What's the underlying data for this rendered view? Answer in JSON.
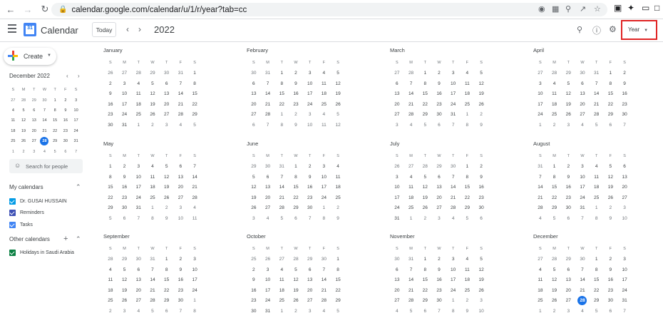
{
  "browser": {
    "url": "calendar.google.com/calendar/u/1/r/year?tab=cc"
  },
  "header": {
    "app_name": "Calendar",
    "logo_text": "31",
    "today_label": "Today",
    "year": "2022",
    "view": "Year"
  },
  "sidebar": {
    "create_label": "Create",
    "mini_title": "December 2022",
    "mini_heads": [
      "S",
      "M",
      "T",
      "W",
      "T",
      "F",
      "S"
    ],
    "mini_weeks": [
      [
        27,
        28,
        29,
        30,
        1,
        2,
        3
      ],
      [
        4,
        5,
        6,
        7,
        8,
        9,
        10
      ],
      [
        11,
        12,
        13,
        14,
        15,
        16,
        17
      ],
      [
        18,
        19,
        20,
        21,
        22,
        23,
        24
      ],
      [
        25,
        26,
        27,
        28,
        29,
        30,
        31
      ],
      [
        1,
        2,
        3,
        4,
        5,
        6,
        7
      ]
    ],
    "mini_outside": [
      [
        1,
        1,
        1,
        1,
        0,
        0,
        0
      ],
      [
        0,
        0,
        0,
        0,
        0,
        0,
        0
      ],
      [
        0,
        0,
        0,
        0,
        0,
        0,
        0
      ],
      [
        0,
        0,
        0,
        0,
        0,
        0,
        0
      ],
      [
        0,
        0,
        0,
        0,
        0,
        0,
        0
      ],
      [
        1,
        1,
        1,
        1,
        1,
        1,
        1
      ]
    ],
    "today_day": 28,
    "search_people": "Search for people",
    "my_calendars_title": "My calendars",
    "my_calendars": [
      {
        "label": "Dr. GUSAI HUSSAIN",
        "color": "#039be5"
      },
      {
        "label": "Reminders",
        "color": "#3f51b5"
      },
      {
        "label": "Tasks",
        "color": "#4285f4"
      }
    ],
    "other_calendars_title": "Other calendars",
    "other_calendars": [
      {
        "label": "Holidays in Saudi Arabia",
        "color": "#0b8043"
      }
    ]
  },
  "weekday_heads": [
    "S",
    "M",
    "T",
    "W",
    "T",
    "F",
    "S"
  ],
  "months": [
    {
      "name": "January",
      "weeks": [
        [
          26,
          27,
          28,
          29,
          30,
          31,
          1
        ],
        [
          2,
          3,
          4,
          5,
          6,
          7,
          8
        ],
        [
          9,
          10,
          11,
          12,
          13,
          14,
          15
        ],
        [
          16,
          17,
          18,
          19,
          20,
          21,
          22
        ],
        [
          23,
          24,
          25,
          26,
          27,
          28,
          29
        ],
        [
          30,
          31,
          1,
          2,
          3,
          4,
          5
        ]
      ]
    },
    {
      "name": "February",
      "weeks": [
        [
          30,
          31,
          1,
          2,
          3,
          4,
          5
        ],
        [
          6,
          7,
          8,
          9,
          10,
          11,
          12
        ],
        [
          13,
          14,
          15,
          16,
          17,
          18,
          19
        ],
        [
          20,
          21,
          22,
          23,
          24,
          25,
          26
        ],
        [
          27,
          28,
          1,
          2,
          3,
          4,
          5
        ],
        [
          6,
          7,
          8,
          9,
          10,
          11,
          12
        ]
      ]
    },
    {
      "name": "March",
      "weeks": [
        [
          27,
          28,
          1,
          2,
          3,
          4,
          5
        ],
        [
          6,
          7,
          8,
          9,
          10,
          11,
          12
        ],
        [
          13,
          14,
          15,
          16,
          17,
          18,
          19
        ],
        [
          20,
          21,
          22,
          23,
          24,
          25,
          26
        ],
        [
          27,
          28,
          29,
          30,
          31,
          1,
          2
        ],
        [
          3,
          4,
          5,
          6,
          7,
          8,
          9
        ]
      ]
    },
    {
      "name": "April",
      "weeks": [
        [
          27,
          28,
          29,
          30,
          31,
          1,
          2
        ],
        [
          3,
          4,
          5,
          6,
          7,
          8,
          9
        ],
        [
          10,
          11,
          12,
          13,
          14,
          15,
          16
        ],
        [
          17,
          18,
          19,
          20,
          21,
          22,
          23
        ],
        [
          24,
          25,
          26,
          27,
          28,
          29,
          30
        ],
        [
          1,
          2,
          3,
          4,
          5,
          6,
          7
        ]
      ]
    },
    {
      "name": "May",
      "weeks": [
        [
          1,
          2,
          3,
          4,
          5,
          6,
          7
        ],
        [
          8,
          9,
          10,
          11,
          12,
          13,
          14
        ],
        [
          15,
          16,
          17,
          18,
          19,
          20,
          21
        ],
        [
          22,
          23,
          24,
          25,
          26,
          27,
          28
        ],
        [
          29,
          30,
          31,
          1,
          2,
          3,
          4
        ],
        [
          5,
          6,
          7,
          8,
          9,
          10,
          11
        ]
      ]
    },
    {
      "name": "June",
      "weeks": [
        [
          29,
          30,
          31,
          1,
          2,
          3,
          4
        ],
        [
          5,
          6,
          7,
          8,
          9,
          10,
          11
        ],
        [
          12,
          13,
          14,
          15,
          16,
          17,
          18
        ],
        [
          19,
          20,
          21,
          22,
          23,
          24,
          25
        ],
        [
          26,
          27,
          28,
          29,
          30,
          1,
          2
        ],
        [
          3,
          4,
          5,
          6,
          7,
          8,
          9
        ]
      ]
    },
    {
      "name": "July",
      "weeks": [
        [
          26,
          27,
          28,
          29,
          30,
          1,
          2
        ],
        [
          3,
          4,
          5,
          6,
          7,
          8,
          9
        ],
        [
          10,
          11,
          12,
          13,
          14,
          15,
          16
        ],
        [
          17,
          18,
          19,
          20,
          21,
          22,
          23
        ],
        [
          24,
          25,
          26,
          27,
          28,
          29,
          30
        ],
        [
          31,
          1,
          2,
          3,
          4,
          5,
          6
        ]
      ]
    },
    {
      "name": "August",
      "weeks": [
        [
          31,
          1,
          2,
          3,
          4,
          5,
          6
        ],
        [
          7,
          8,
          9,
          10,
          11,
          12,
          13
        ],
        [
          14,
          15,
          16,
          17,
          18,
          19,
          20
        ],
        [
          21,
          22,
          23,
          24,
          25,
          26,
          27
        ],
        [
          28,
          29,
          30,
          31,
          1,
          2,
          3
        ],
        [
          4,
          5,
          6,
          7,
          8,
          9,
          10
        ]
      ]
    },
    {
      "name": "September",
      "weeks": [
        [
          28,
          29,
          30,
          31,
          1,
          2,
          3
        ],
        [
          4,
          5,
          6,
          7,
          8,
          9,
          10
        ],
        [
          11,
          12,
          13,
          14,
          15,
          16,
          17
        ],
        [
          18,
          19,
          20,
          21,
          22,
          23,
          24
        ],
        [
          25,
          26,
          27,
          28,
          29,
          30,
          1
        ],
        [
          2,
          3,
          4,
          5,
          6,
          7,
          8
        ]
      ]
    },
    {
      "name": "October",
      "weeks": [
        [
          25,
          26,
          27,
          28,
          29,
          30,
          1
        ],
        [
          2,
          3,
          4,
          5,
          6,
          7,
          8
        ],
        [
          9,
          10,
          11,
          12,
          13,
          14,
          15
        ],
        [
          16,
          17,
          18,
          19,
          20,
          21,
          22
        ],
        [
          23,
          24,
          25,
          26,
          27,
          28,
          29
        ],
        [
          30,
          31,
          1,
          2,
          3,
          4,
          5
        ]
      ]
    },
    {
      "name": "November",
      "weeks": [
        [
          30,
          31,
          1,
          2,
          3,
          4,
          5
        ],
        [
          6,
          7,
          8,
          9,
          10,
          11,
          12
        ],
        [
          13,
          14,
          15,
          16,
          17,
          18,
          19
        ],
        [
          20,
          21,
          22,
          23,
          24,
          25,
          26
        ],
        [
          27,
          28,
          29,
          30,
          1,
          2,
          3
        ],
        [
          4,
          5,
          6,
          7,
          8,
          9,
          10
        ]
      ]
    },
    {
      "name": "December",
      "weeks": [
        [
          27,
          28,
          29,
          30,
          1,
          2,
          3
        ],
        [
          4,
          5,
          6,
          7,
          8,
          9,
          10
        ],
        [
          11,
          12,
          13,
          14,
          15,
          16,
          17
        ],
        [
          18,
          19,
          20,
          21,
          22,
          23,
          24
        ],
        [
          25,
          26,
          27,
          28,
          29,
          30,
          31
        ],
        [
          1,
          2,
          3,
          4,
          5,
          6,
          7
        ]
      ]
    }
  ],
  "today_month_index": 11,
  "highlight_color": "#e02424",
  "accent_color": "#1a73e8"
}
